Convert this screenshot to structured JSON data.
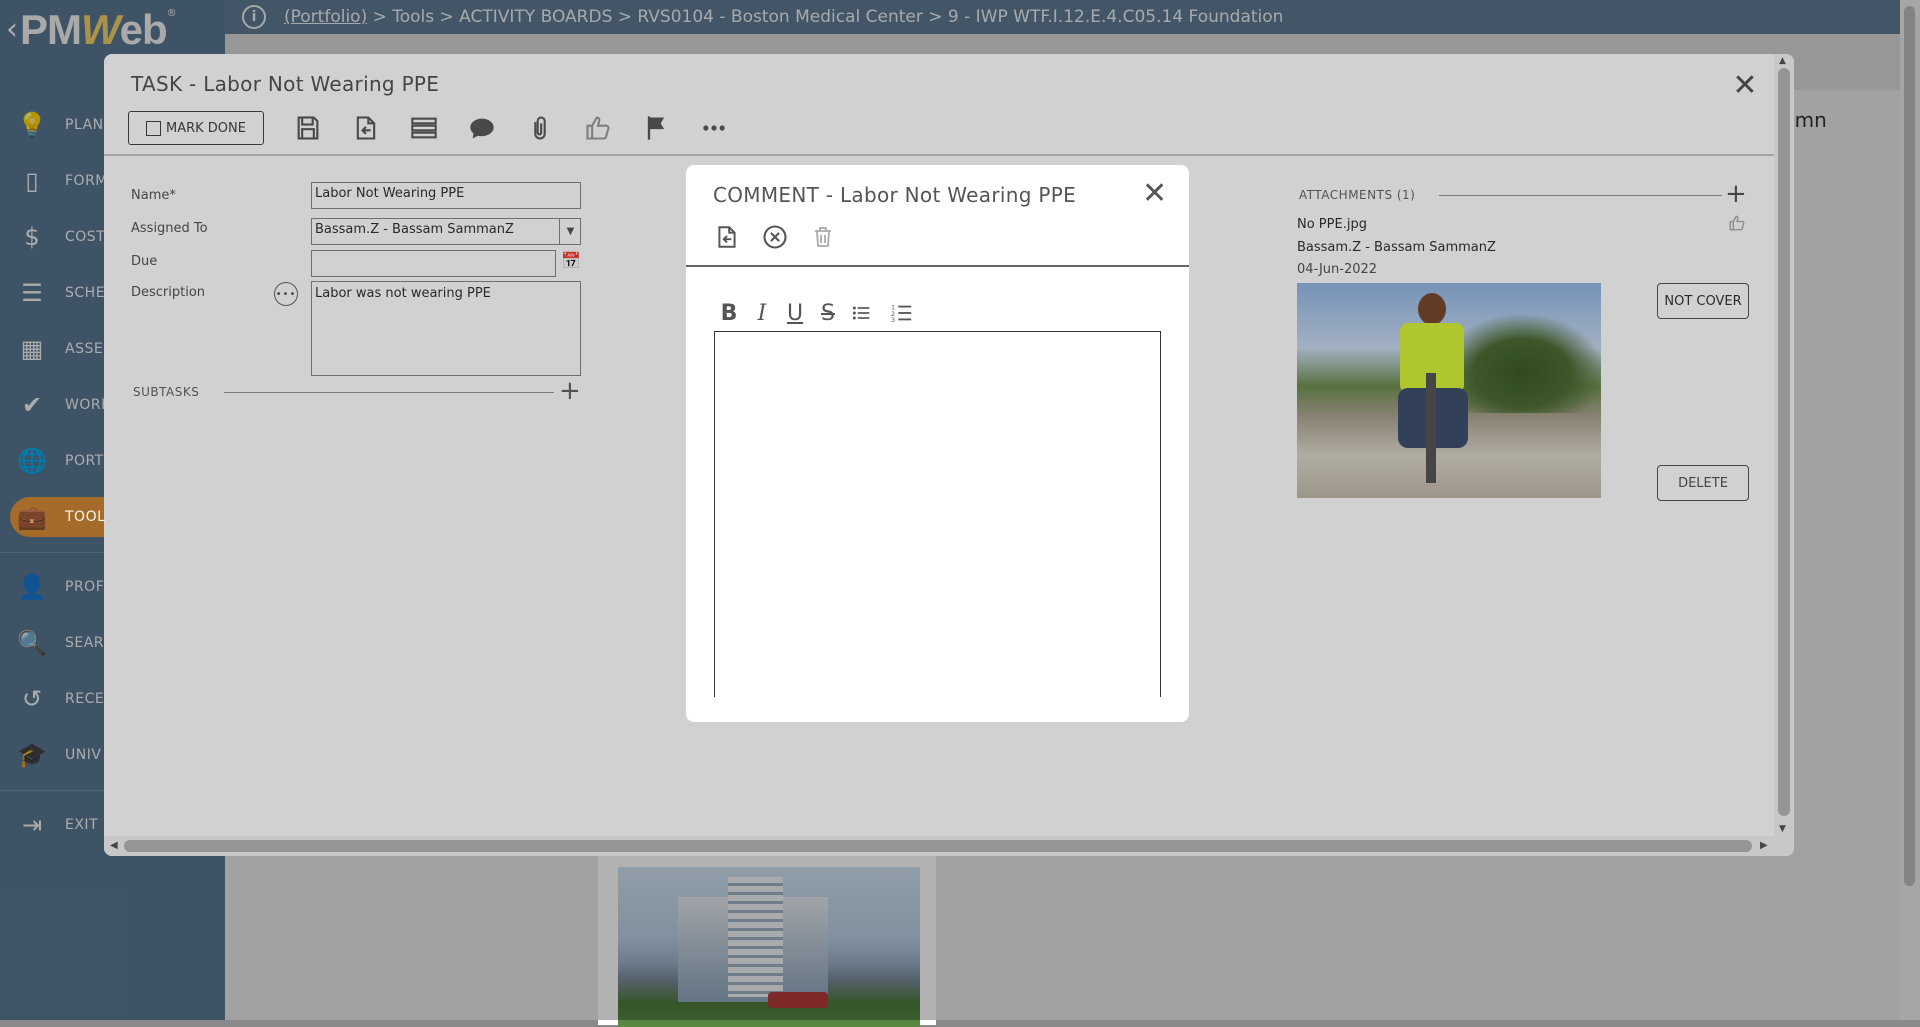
{
  "brand": {
    "back": "‹",
    "logo_pm": "PM",
    "logo_w": "W",
    "logo_eb": "eb",
    "registered": "®"
  },
  "nav": {
    "items": [
      {
        "icon": "lightbulb-icon",
        "glyph": "💡",
        "label": "PLAN"
      },
      {
        "icon": "form-icon",
        "glyph": "▯",
        "label": "FORM"
      },
      {
        "icon": "dollar-icon",
        "glyph": "$",
        "label": "COST"
      },
      {
        "icon": "schedule-icon",
        "glyph": "☰",
        "label": "SCHE"
      },
      {
        "icon": "building-icon",
        "glyph": "▦",
        "label": "ASSE"
      },
      {
        "icon": "checkmark-icon",
        "glyph": "✔",
        "label": "WORK"
      },
      {
        "icon": "globe-icon",
        "glyph": "🌐",
        "label": "PORT"
      },
      {
        "icon": "briefcase-icon",
        "glyph": "💼",
        "label": "TOOL"
      },
      {
        "icon": "user-icon",
        "glyph": "👤",
        "label": "PROF"
      },
      {
        "icon": "search-icon",
        "glyph": "🔍",
        "label": "SEAR"
      },
      {
        "icon": "history-icon",
        "glyph": "↺",
        "label": "RECE"
      },
      {
        "icon": "graduation-cap-icon",
        "glyph": "🎓",
        "label": "UNIV"
      },
      {
        "icon": "exit-icon",
        "glyph": "⇥",
        "label": "EXIT"
      }
    ],
    "active_label": "TOOL"
  },
  "topbar": {
    "portfolio_link": "(Portfolio)",
    "breadcrumb_rest": " > Tools > ACTIVITY BOARDS > RVS0104 - Boston Medical Center > 9 - IWP WTF.I.12.E.4.C05.14 Foundation"
  },
  "background": {
    "column_label_fragment": "umn"
  },
  "task": {
    "title": "TASK - Labor Not Wearing PPE",
    "mark_done": "MARK DONE",
    "fields": {
      "name_label": "Name*",
      "name_value": "Labor Not Wearing PPE",
      "assigned_label": "Assigned To",
      "assigned_value": "Bassam.Z - Bassam SammanZ",
      "due_label": "Due",
      "due_value": "",
      "description_label": "Description",
      "description_value": "Labor was not wearing PPE"
    },
    "subtasks_label": "SUBTASKS",
    "attachments": {
      "label": "ATTACHMENTS (1)",
      "file_name": "No PPE.jpg",
      "uploaded_by": "Bassam.Z - Bassam SammanZ",
      "date": "04-Jun-2022",
      "not_cover_button": "NOT COVER",
      "delete_button": "DELETE"
    }
  },
  "comment": {
    "title": "COMMENT - Labor Not Wearing PPE",
    "body": "",
    "rte": {
      "bold": "B",
      "italic": "I",
      "underline": "U",
      "strike": "S"
    }
  }
}
